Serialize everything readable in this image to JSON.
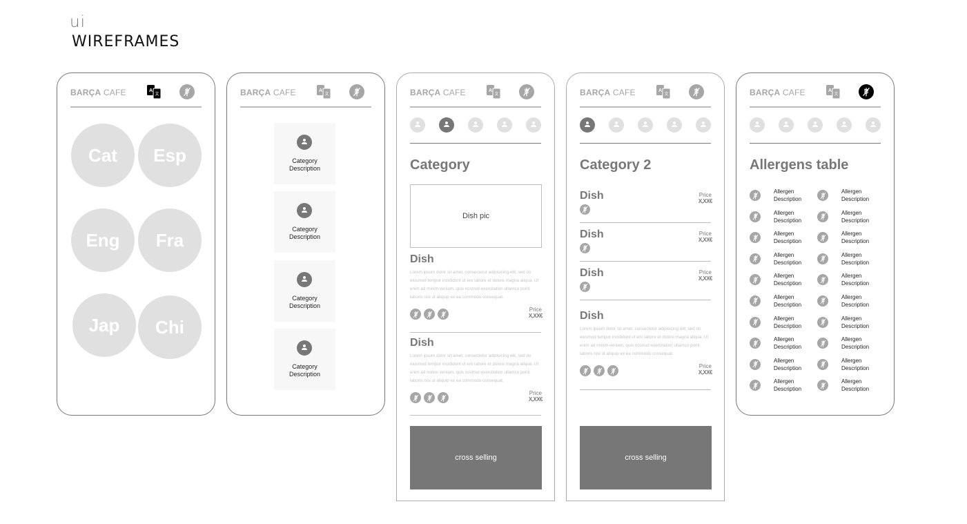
{
  "page": {
    "subtitle": "ui",
    "title": "WIREFRAMES"
  },
  "common": {
    "brand_bold": "BARÇA",
    "brand_light": " CAFE",
    "lang_icon": "translate-icon",
    "allergen_icon": "gluten-free-icon",
    "category_icon": "person-icon",
    "colors": {
      "primary_gray": "#777777",
      "light_gray": "#e0e0e0",
      "mid_gray": "#a6a6a6",
      "active": "#000000"
    }
  },
  "screen1": {
    "name": "language-selection",
    "languages": [
      "Cat",
      "Esp",
      "Eng",
      "Fra",
      "Jap",
      "Chi"
    ]
  },
  "screen2": {
    "name": "category-list",
    "categories": [
      {
        "title": "Category",
        "desc": "Description"
      },
      {
        "title": "Category",
        "desc": "Description"
      },
      {
        "title": "Category",
        "desc": "Description"
      },
      {
        "title": "Category",
        "desc": "Description"
      }
    ]
  },
  "screen3": {
    "title": "Category",
    "active_tab": 1,
    "dish_pic": "Dish pic",
    "dishes": [
      {
        "name": "Dish",
        "desc": "Lorem ipsum dolor sit amet, consectetur adipisicing elit, sed do eiusmod tempor incididunt ut ero labore et dolore magna aliqua. Ut enim ad minim veniam, quis nostrud exercitation ullamco poriti laboris nisi ut aliquip ex ea commodo consequat.",
        "price_label": "Price",
        "price": "X,XX€",
        "allergens": 3
      },
      {
        "name": "Dish",
        "desc": "Lorem ipsum dolor sit amet, consectetur adipisicing elit, sed do eiusmod tempor incididunt ut ero labore et dolore magna aliqua. Ut enim ad minim veniam, quis nostrud exercitation ullamco poriti laboris nisi ut aliquip ex ea commodo consequat.",
        "price_label": "Price",
        "price": "X,XX€",
        "allergens": 3
      }
    ],
    "cross_selling": "cross selling"
  },
  "screen4": {
    "title": "Category 2",
    "active_tab": 0,
    "dishes": [
      {
        "name": "Dish",
        "price_label": "Price",
        "price": "X,XX€",
        "allergens": 1
      },
      {
        "name": "Dish",
        "price_label": "Price",
        "price": "X,XX€",
        "allergens": 1
      },
      {
        "name": "Dish",
        "price_label": "Price",
        "price": "X,XX€",
        "allergens": 1
      },
      {
        "name": "Dish",
        "desc": "Lorem ipsum dolor sit amet, consectetur adipisicing elit, sed do eiusmod tempor incididunt ut ero labore et dolore magna aliqua. Ut enim ad minim veniam, quis nostrud exercitation ullamco poriti laboris nisi ut aliquip ex ea commodo consequat.",
        "price_label": "Price",
        "price": "X,XX€",
        "allergens": 3
      }
    ],
    "cross_selling": "cross selling"
  },
  "screen5": {
    "title": "Allergens table",
    "allergen_active": true,
    "rows": 10,
    "item": {
      "title": "Allergen",
      "desc": "Description"
    }
  }
}
